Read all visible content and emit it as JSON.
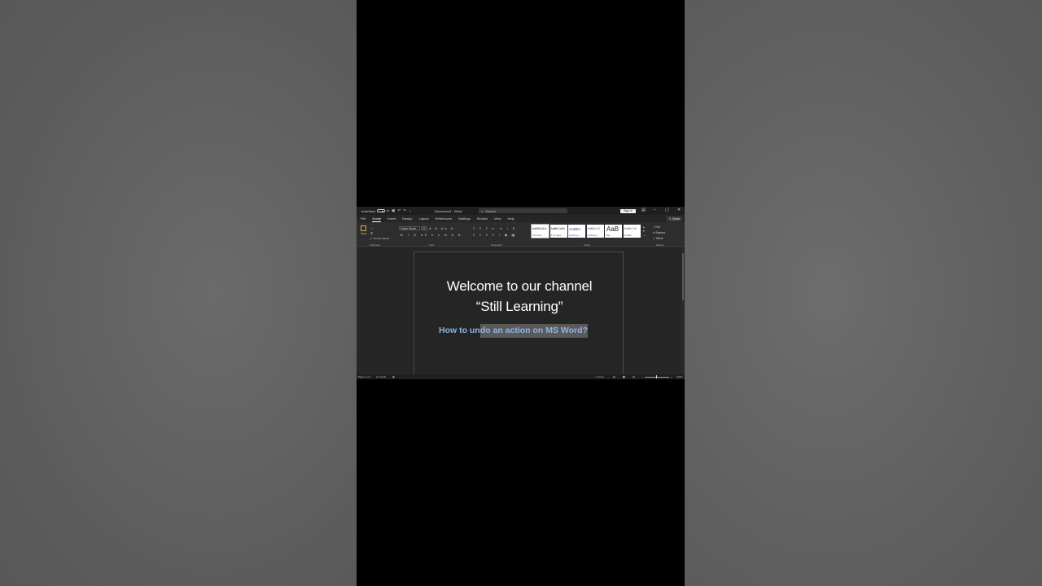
{
  "titlebar": {
    "autosave_label": "AutoSave",
    "autosave_state": "Off",
    "doc_title": "Document1 - Word",
    "search_placeholder": "Search",
    "signin_label": "Sign in"
  },
  "tabs": [
    "File",
    "Home",
    "Insert",
    "Design",
    "Layout",
    "References",
    "Mailings",
    "Review",
    "View",
    "Help"
  ],
  "share_label": "Share",
  "ribbon": {
    "paste_label": "Paste",
    "format_painter_label": "Format Painter",
    "font_name": "Calibri (Body)",
    "font_size": "20",
    "styles": [
      {
        "preview": "AaBbCcDc",
        "name": "¶ Normal"
      },
      {
        "preview": "AaBbCcDc",
        "name": "¶ No Spac..."
      },
      {
        "preview": "AaBbC",
        "name": "Heading 1"
      },
      {
        "preview": "AaBbCcC",
        "name": "Heading 2"
      },
      {
        "preview": "AaB",
        "name": "Title"
      },
      {
        "preview": "AaBbCcD",
        "name": "Subtitle"
      }
    ],
    "editing": {
      "find": "Find",
      "replace": "Replace",
      "select": "Select"
    },
    "group_labels": {
      "clipboard": "Clipboard",
      "font": "Font",
      "paragraph": "Paragraph",
      "styles": "Styles",
      "editing": "Editing"
    }
  },
  "document": {
    "line1": "Welcome to our channel",
    "line2": "“Still Learning”",
    "subtitle_unselected": "How to un",
    "subtitle_selected": "do an action on MS Word?"
  },
  "statusbar": {
    "page": "Page 1 of 1",
    "words": "14 words",
    "focus": "Focus",
    "zoom": "100%"
  },
  "colors": {
    "subtitle_text": "#8fb4e3",
    "ribbon_bg": "#2d2d2d",
    "doc_bg": "#262626"
  }
}
